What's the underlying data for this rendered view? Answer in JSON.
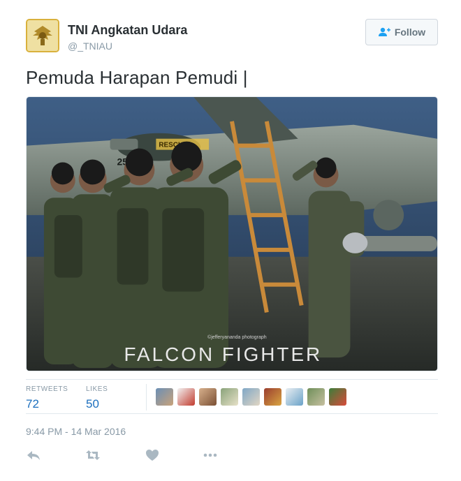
{
  "account": {
    "name": "TNI Angkatan Udara",
    "handle": "@_TNIAU"
  },
  "follow_button": {
    "label": "Follow",
    "icon": "add-user-icon"
  },
  "tweet": {
    "text": "Pemuda Harapan Pemudi |",
    "timestamp": "9:44 PM - 14 Mar 2016"
  },
  "photo": {
    "title": "FALCON FIGHTER",
    "credit": "©jefferyananda photograph",
    "rescue_label": "RESCUE"
  },
  "stats": {
    "retweets_label": "RETWEETS",
    "retweets": "72",
    "likes_label": "LIKES",
    "likes": "50"
  },
  "actions": [
    "reply-icon",
    "retweet-icon",
    "like-icon",
    "more-icon"
  ],
  "colors": {
    "link": "#1c6fbe",
    "muted": "#8899a6",
    "text": "#292f33",
    "border": "#e1e8ed"
  }
}
